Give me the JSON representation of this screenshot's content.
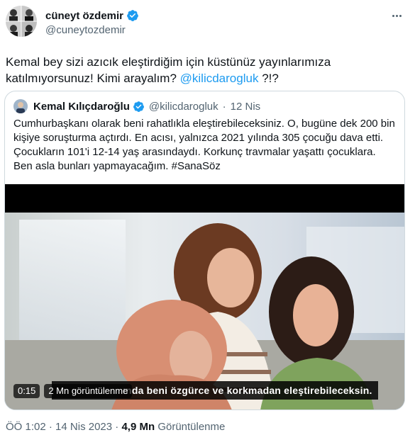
{
  "tweet": {
    "author": {
      "display_name": "cüneyt özdemir",
      "handle": "@cuneytozdemir",
      "verified": true,
      "verified_color": "#1d9bf0"
    },
    "more_icon": "more-horizontal-icon",
    "text_part1": "Kemal bey sizi azıcık eleştirdiğim için küstünüz yayınlarımıza katılmıyorsunuz! Kimi arayalım?",
    "mention": "@kilicdarogluk",
    "text_part2": "?!?",
    "mention_color": "#1d9bf0"
  },
  "quote": {
    "author": {
      "display_name": "Kemal Kılıçdaroğlu",
      "handle": "@kilicdarogluk",
      "separator": "·",
      "date": "12 Nis",
      "verified": true
    },
    "text": "Cumhurbaşkanı olarak beni rahatlıkla eleştirebileceksiniz. O, bugüne dek 200 bin kişiye soruşturma açtırdı. En acısı, yalnızca 2021 yılında 305 çocuğu dava etti. Çocukların 101'i 12-14 yaş arasındaydı. Korkunç travmalar yaşattı çocuklara. Ben asla bunları yapmayacağım. #SanaSöz",
    "video": {
      "timestamp": "0:15",
      "views": "2 Mn görüntülenme",
      "caption": "ında beni özgürce ve korkmadan eleştirebileceksin."
    }
  },
  "footer": {
    "time": "ÖÖ 1:02",
    "separator1": "·",
    "date": "14 Nis 2023",
    "separator2": "·",
    "view_count": "4,9 Mn",
    "view_label": "Görüntülenme"
  },
  "colors": {
    "text_primary": "#0f1419",
    "text_secondary": "#536471",
    "border": "#cfd9de",
    "accent": "#1d9bf0"
  }
}
